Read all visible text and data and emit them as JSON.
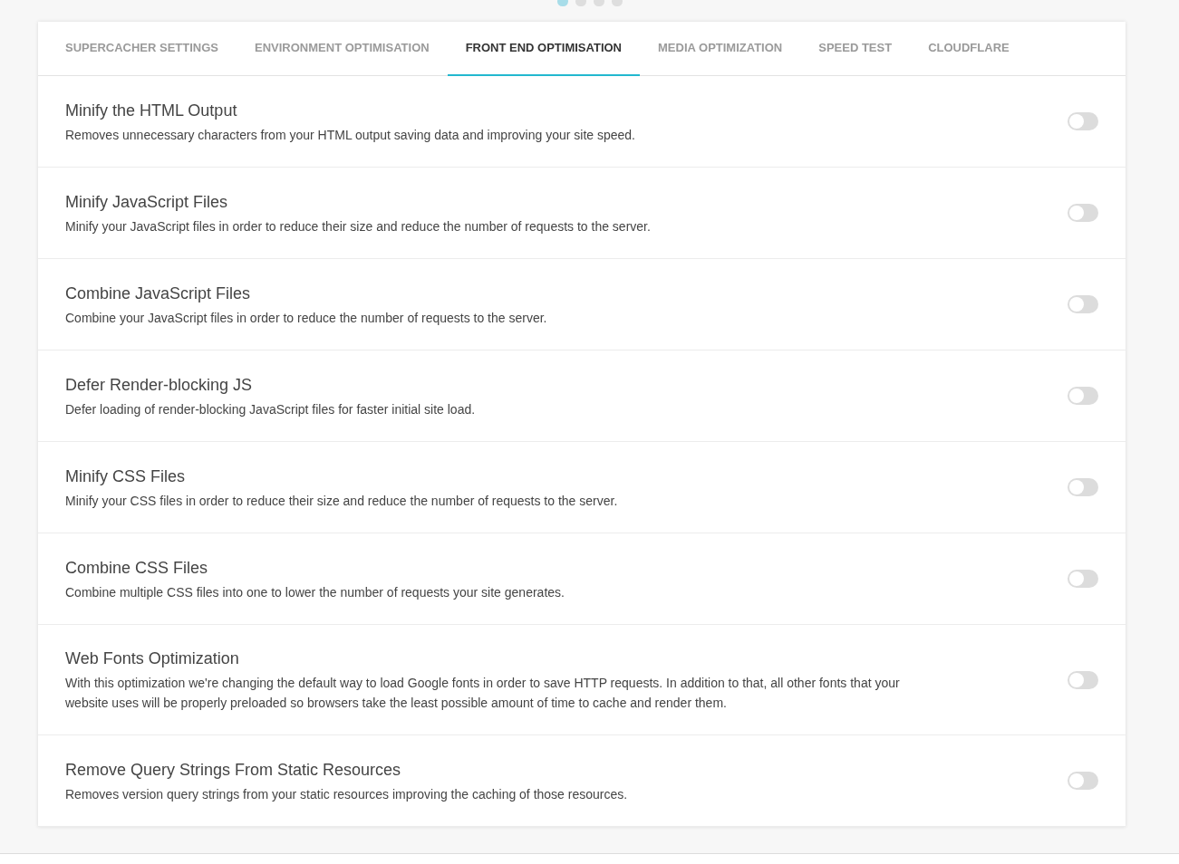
{
  "pager": [
    {
      "selected": true
    },
    {
      "selected": false
    },
    {
      "selected": false
    },
    {
      "selected": false
    }
  ],
  "tabs": [
    {
      "label": "SUPERCACHER SETTINGS",
      "selected": false
    },
    {
      "label": "ENVIRONMENT OPTIMISATION",
      "selected": false
    },
    {
      "label": "FRONT END OPTIMISATION",
      "selected": true
    },
    {
      "label": "MEDIA OPTIMIZATION",
      "selected": false
    },
    {
      "label": "SPEED TEST",
      "selected": false
    },
    {
      "label": "CLOUDFLARE",
      "selected": false
    }
  ],
  "settings": [
    {
      "title": "Minify the HTML Output",
      "description": "Removes unnecessary characters from your HTML output saving data and improving your site speed.",
      "on": false
    },
    {
      "title": "Minify JavaScript Files",
      "description": "Minify your JavaScript files in order to reduce their size and reduce the number of requests to the server.",
      "on": false
    },
    {
      "title": "Combine JavaScript Files",
      "description": "Combine your JavaScript files in order to reduce the number of requests to the server.",
      "on": false
    },
    {
      "title": "Defer Render-blocking JS",
      "description": "Defer loading of render-blocking JavaScript files for faster initial site load.",
      "on": false
    },
    {
      "title": "Minify CSS Files",
      "description": "Minify your CSS files in order to reduce their size and reduce the number of requests to the server.",
      "on": false
    },
    {
      "title": "Combine CSS Files",
      "description": "Combine multiple CSS files into one to lower the number of requests your site generates.",
      "on": false
    },
    {
      "title": "Web Fonts Optimization",
      "description": "With this optimization we're changing the default way to load Google fonts in order to save HTTP requests. In addition to that, all other fonts that your website uses will be properly preloaded so browsers take the least possible amount of time to cache and render them.",
      "on": false
    },
    {
      "title": "Remove Query Strings From Static Resources",
      "description": "Removes version query strings from your static resources improving the caching of those resources.",
      "on": false
    }
  ]
}
